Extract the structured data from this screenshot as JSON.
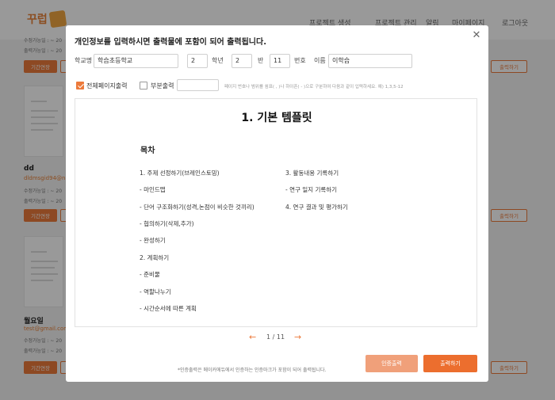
{
  "background": {
    "nav": [
      "프로젝트 생성",
      "프로젝트 관리",
      "알림",
      "마이페이지",
      "로그아웃"
    ],
    "cards": [
      {
        "name": "",
        "email": "",
        "meta1": "수정가능일 : ~ 20",
        "meta2": "출력가능일 : ~ 20",
        "button": "기간연장"
      },
      {
        "name": "dd",
        "email": "dldmsgid94@nav",
        "meta1": "수정가능일 : ~ 20",
        "meta2": "출력가능일 : ~ 20",
        "button": "기간연장"
      },
      {
        "name": "월요일",
        "email": "test@gmail.com",
        "meta1": "수정가능일 : ~ 20",
        "meta2": "출력가능일 : ~ 20",
        "button": "기간연장"
      }
    ],
    "out_button": "출력하기"
  },
  "modal": {
    "title": "개인정보를 입력하시면 출력물에 포함이 되어 출력됩니다.",
    "close": "✕",
    "form": {
      "school_label": "학교명",
      "school_value": "학습초등학교",
      "grade_value": "2",
      "grade_label": "학년",
      "class_value": "2",
      "class_label": "반",
      "number_value": "11",
      "number_label": "번호",
      "name_label": "이름",
      "name_value": "이학습"
    },
    "options": {
      "all_pages_label": "전체페이지출력",
      "all_pages_checked": true,
      "partial_label": "부분출력",
      "partial_checked": false,
      "page_input_value": "",
      "hint": "페이지 번호나 범위를 쉼표( , )나 하이픈( - )으로 구분하여 다음과 같이 입력하세요. 예) 1,3,5-12"
    },
    "preview": {
      "doc_title": "1. 기본 템플릿",
      "toc_heading": "목차",
      "toc_left": [
        "1. 주제 선정하기(브레인스토밍)",
        "- 마인드맵",
        "- 단어 구조화하기(성격,논점이 비슷한 것끼리)",
        "- 협의하기(삭제,추가)",
        "- 완성하기",
        "2. 계획하기",
        "- 준비물",
        "- 역할나누기",
        "- 시간순서에 따른 계획"
      ],
      "toc_right": [
        "3. 활동내용 기록하기",
        "- 연구 일지 기록하기",
        "4. 연구 결과 및 평가하기"
      ]
    },
    "pager": {
      "prev": "←",
      "current": "1",
      "separator": "/",
      "total": "11",
      "next": "→",
      "text": "1 / 11"
    },
    "footer_note": "*인증출력은 메이커에듀에서 인증하는 인증마크가 포함이 되어 출력됩니다.",
    "auth_button": "인증출력",
    "print_button": "출력하기",
    "accent_color": "#ec6e2e"
  }
}
